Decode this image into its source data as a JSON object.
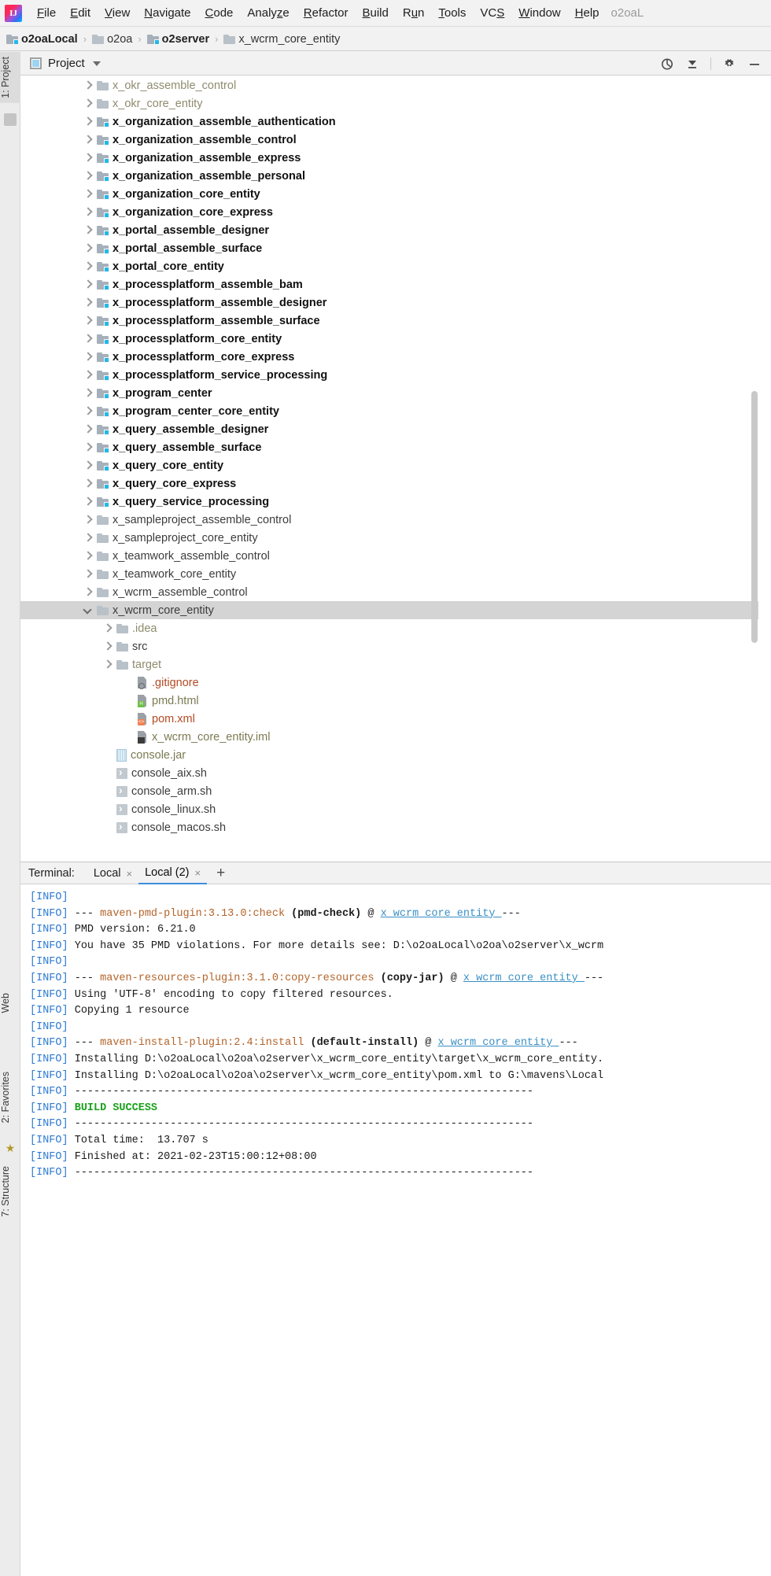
{
  "window": {
    "app_title_truncated": "o2oaL"
  },
  "menubar": {
    "items": [
      {
        "label": "File",
        "mnemonic": "F"
      },
      {
        "label": "Edit",
        "mnemonic": "E"
      },
      {
        "label": "View",
        "mnemonic": "V"
      },
      {
        "label": "Navigate",
        "mnemonic": "N"
      },
      {
        "label": "Code",
        "mnemonic": "C"
      },
      {
        "label": "Analyze",
        "mnemonic": "z"
      },
      {
        "label": "Refactor",
        "mnemonic": "R"
      },
      {
        "label": "Build",
        "mnemonic": "B"
      },
      {
        "label": "Run",
        "mnemonic": "u"
      },
      {
        "label": "Tools",
        "mnemonic": "T"
      },
      {
        "label": "VCS",
        "mnemonic": "S"
      },
      {
        "label": "Window",
        "mnemonic": "W"
      },
      {
        "label": "Help",
        "mnemonic": "H"
      }
    ]
  },
  "breadcrumb": {
    "items": [
      {
        "label": "o2oaLocal",
        "bold": true,
        "module": true
      },
      {
        "label": "o2oa",
        "bold": false,
        "module": false
      },
      {
        "label": "o2server",
        "bold": true,
        "module": true
      },
      {
        "label": "x_wcrm_core_entity",
        "bold": false,
        "module": false
      }
    ],
    "separator": "›"
  },
  "left_tool_strip": {
    "tabs": [
      {
        "label": "1: Project",
        "active": true
      },
      {
        "label": "Web",
        "active": false
      },
      {
        "label": "2: Favorites",
        "active": false
      },
      {
        "label": "7: Structure",
        "active": false
      }
    ]
  },
  "project_panel": {
    "title": "Project",
    "dropdown_icon": "chevron-down-icon",
    "actions": [
      {
        "name": "locate-in-tree-icon"
      },
      {
        "name": "collapse-all-icon"
      },
      {
        "name": "settings-gear-icon"
      },
      {
        "name": "hide-panel-icon"
      }
    ],
    "tree": [
      {
        "label": "x_okr_assemble_control",
        "indent": 1,
        "arrow": "right",
        "icon": "folder",
        "style": "dim"
      },
      {
        "label": "x_okr_core_entity",
        "indent": 1,
        "arrow": "right",
        "icon": "folder",
        "style": "dim"
      },
      {
        "label": "x_organization_assemble_authentication",
        "indent": 1,
        "arrow": "right",
        "icon": "module",
        "style": "module"
      },
      {
        "label": "x_organization_assemble_control",
        "indent": 1,
        "arrow": "right",
        "icon": "module",
        "style": "module"
      },
      {
        "label": "x_organization_assemble_express",
        "indent": 1,
        "arrow": "right",
        "icon": "module",
        "style": "module"
      },
      {
        "label": "x_organization_assemble_personal",
        "indent": 1,
        "arrow": "right",
        "icon": "module",
        "style": "module"
      },
      {
        "label": "x_organization_core_entity",
        "indent": 1,
        "arrow": "right",
        "icon": "module",
        "style": "module"
      },
      {
        "label": "x_organization_core_express",
        "indent": 1,
        "arrow": "right",
        "icon": "module",
        "style": "module"
      },
      {
        "label": "x_portal_assemble_designer",
        "indent": 1,
        "arrow": "right",
        "icon": "module",
        "style": "module"
      },
      {
        "label": "x_portal_assemble_surface",
        "indent": 1,
        "arrow": "right",
        "icon": "module",
        "style": "module"
      },
      {
        "label": "x_portal_core_entity",
        "indent": 1,
        "arrow": "right",
        "icon": "module",
        "style": "module"
      },
      {
        "label": "x_processplatform_assemble_bam",
        "indent": 1,
        "arrow": "right",
        "icon": "module",
        "style": "module"
      },
      {
        "label": "x_processplatform_assemble_designer",
        "indent": 1,
        "arrow": "right",
        "icon": "module",
        "style": "module"
      },
      {
        "label": "x_processplatform_assemble_surface",
        "indent": 1,
        "arrow": "right",
        "icon": "module",
        "style": "module"
      },
      {
        "label": "x_processplatform_core_entity",
        "indent": 1,
        "arrow": "right",
        "icon": "module",
        "style": "module"
      },
      {
        "label": "x_processplatform_core_express",
        "indent": 1,
        "arrow": "right",
        "icon": "module",
        "style": "module"
      },
      {
        "label": "x_processplatform_service_processing",
        "indent": 1,
        "arrow": "right",
        "icon": "module",
        "style": "module"
      },
      {
        "label": "x_program_center",
        "indent": 1,
        "arrow": "right",
        "icon": "module",
        "style": "module"
      },
      {
        "label": "x_program_center_core_entity",
        "indent": 1,
        "arrow": "right",
        "icon": "module",
        "style": "module"
      },
      {
        "label": "x_query_assemble_designer",
        "indent": 1,
        "arrow": "right",
        "icon": "module",
        "style": "module"
      },
      {
        "label": "x_query_assemble_surface",
        "indent": 1,
        "arrow": "right",
        "icon": "module",
        "style": "module"
      },
      {
        "label": "x_query_core_entity",
        "indent": 1,
        "arrow": "right",
        "icon": "module",
        "style": "module"
      },
      {
        "label": "x_query_core_express",
        "indent": 1,
        "arrow": "right",
        "icon": "module",
        "style": "module"
      },
      {
        "label": "x_query_service_processing",
        "indent": 1,
        "arrow": "right",
        "icon": "module",
        "style": "module"
      },
      {
        "label": "x_sampleproject_assemble_control",
        "indent": 1,
        "arrow": "right",
        "icon": "folder",
        "style": "folder"
      },
      {
        "label": "x_sampleproject_core_entity",
        "indent": 1,
        "arrow": "right",
        "icon": "folder",
        "style": "folder"
      },
      {
        "label": "x_teamwork_assemble_control",
        "indent": 1,
        "arrow": "right",
        "icon": "folder",
        "style": "folder"
      },
      {
        "label": "x_teamwork_core_entity",
        "indent": 1,
        "arrow": "right",
        "icon": "folder",
        "style": "folder"
      },
      {
        "label": "x_wcrm_assemble_control",
        "indent": 1,
        "arrow": "right",
        "icon": "folder",
        "style": "folder"
      },
      {
        "label": "x_wcrm_core_entity",
        "indent": 1,
        "arrow": "down",
        "icon": "folder",
        "style": "folder",
        "selected": true
      },
      {
        "label": ".idea",
        "indent": 2,
        "arrow": "right",
        "icon": "folder",
        "style": "dim"
      },
      {
        "label": "src",
        "indent": 2,
        "arrow": "right",
        "icon": "folder",
        "style": "folder"
      },
      {
        "label": "target",
        "indent": 2,
        "arrow": "right",
        "icon": "folder",
        "style": "dim"
      },
      {
        "label": ".gitignore",
        "indent": 3,
        "arrow": "none",
        "icon": "file-ignored",
        "style": "red"
      },
      {
        "label": "pmd.html",
        "indent": 3,
        "arrow": "none",
        "icon": "file-html",
        "style": "olive"
      },
      {
        "label": "pom.xml",
        "indent": 3,
        "arrow": "none",
        "icon": "file-xml",
        "style": "red"
      },
      {
        "label": "x_wcrm_core_entity.iml",
        "indent": 3,
        "arrow": "none",
        "icon": "file-iml",
        "style": "olive"
      },
      {
        "label": "console.jar",
        "indent": 2,
        "arrow": "none",
        "icon": "file-jar",
        "style": "olive"
      },
      {
        "label": "console_aix.sh",
        "indent": 2,
        "arrow": "none",
        "icon": "file-sh",
        "style": "folder"
      },
      {
        "label": "console_arm.sh",
        "indent": 2,
        "arrow": "none",
        "icon": "file-sh",
        "style": "folder"
      },
      {
        "label": "console_linux.sh",
        "indent": 2,
        "arrow": "none",
        "icon": "file-sh",
        "style": "folder"
      },
      {
        "label": "console_macos.sh",
        "indent": 2,
        "arrow": "none",
        "icon": "file-sh",
        "style": "folder"
      }
    ]
  },
  "terminal": {
    "label": "Terminal:",
    "tabs": [
      {
        "label": "Local",
        "active": false,
        "close": "×"
      },
      {
        "label": "Local (2)",
        "active": true,
        "close": "×"
      }
    ],
    "add_tab": "+",
    "lines": [
      [
        {
          "t": "[INFO] ",
          "c": "c-info"
        }
      ],
      [
        {
          "t": "[INFO] ",
          "c": "c-info"
        },
        {
          "t": "--- ",
          "c": "c-dark"
        },
        {
          "t": "maven-pmd-plugin:3.13.0:check ",
          "c": "c-goal"
        },
        {
          "t": "(pmd-check) ",
          "c": "c-phase"
        },
        {
          "t": "@ ",
          "c": "c-dark"
        },
        {
          "t": "x_wcrm_core_entity ",
          "c": "c-proj"
        },
        {
          "t": "---",
          "c": "c-dark"
        }
      ],
      [
        {
          "t": "[INFO] ",
          "c": "c-info"
        },
        {
          "t": "PMD version: 6.21.0",
          "c": "c-dark"
        }
      ],
      [
        {
          "t": "[INFO] ",
          "c": "c-info"
        },
        {
          "t": "You have 35 PMD violations. For more details see: D:\\o2oaLocal\\o2oa\\o2server\\x_wcrm",
          "c": "c-dark"
        }
      ],
      [
        {
          "t": "[INFO] ",
          "c": "c-info"
        }
      ],
      [
        {
          "t": "[INFO] ",
          "c": "c-info"
        },
        {
          "t": "--- ",
          "c": "c-dark"
        },
        {
          "t": "maven-resources-plugin:3.1.0:copy-resources ",
          "c": "c-goal"
        },
        {
          "t": "(copy-jar) ",
          "c": "c-phase"
        },
        {
          "t": "@ ",
          "c": "c-dark"
        },
        {
          "t": "x_wcrm_core_entity ",
          "c": "c-proj"
        },
        {
          "t": "---",
          "c": "c-dark"
        }
      ],
      [
        {
          "t": "[INFO] ",
          "c": "c-info"
        },
        {
          "t": "Using 'UTF-8' encoding to copy filtered resources.",
          "c": "c-dark"
        }
      ],
      [
        {
          "t": "[INFO] ",
          "c": "c-info"
        },
        {
          "t": "Copying 1 resource",
          "c": "c-dark"
        }
      ],
      [
        {
          "t": "[INFO] ",
          "c": "c-info"
        }
      ],
      [
        {
          "t": "[INFO] ",
          "c": "c-info"
        },
        {
          "t": "--- ",
          "c": "c-dark"
        },
        {
          "t": "maven-install-plugin:2.4:install ",
          "c": "c-goal"
        },
        {
          "t": "(default-install) ",
          "c": "c-phase"
        },
        {
          "t": "@ ",
          "c": "c-dark"
        },
        {
          "t": "x_wcrm_core_entity ",
          "c": "c-proj"
        },
        {
          "t": "---",
          "c": "c-dark"
        }
      ],
      [
        {
          "t": "[INFO] ",
          "c": "c-info"
        },
        {
          "t": "Installing D:\\o2oaLocal\\o2oa\\o2server\\x_wcrm_core_entity\\target\\x_wcrm_core_entity.",
          "c": "c-dark"
        }
      ],
      [
        {
          "t": "[INFO] ",
          "c": "c-info"
        },
        {
          "t": "Installing D:\\o2oaLocal\\o2oa\\o2server\\x_wcrm_core_entity\\pom.xml to G:\\mavens\\Local",
          "c": "c-dark"
        }
      ],
      [
        {
          "t": "[INFO] ",
          "c": "c-info"
        },
        {
          "t": "------------------------------------------------------------------------",
          "c": "c-dark"
        }
      ],
      [
        {
          "t": "[INFO] ",
          "c": "c-info"
        },
        {
          "t": "BUILD SUCCESS",
          "c": "c-green"
        }
      ],
      [
        {
          "t": "[INFO] ",
          "c": "c-info"
        },
        {
          "t": "------------------------------------------------------------------------",
          "c": "c-dark"
        }
      ],
      [
        {
          "t": "[INFO] ",
          "c": "c-info"
        },
        {
          "t": "Total time:  13.707 s",
          "c": "c-dark"
        }
      ],
      [
        {
          "t": "[INFO] ",
          "c": "c-info"
        },
        {
          "t": "Finished at: 2021-02-23T15:00:12+08:00",
          "c": "c-dark"
        }
      ],
      [
        {
          "t": "[INFO] ",
          "c": "c-info"
        },
        {
          "t": "------------------------------------------------------------------------",
          "c": "c-dark"
        }
      ]
    ]
  },
  "colors": {
    "accent_blue": "#24b8e8",
    "info_blue": "#2e7ad1",
    "success_green": "#1aa11a",
    "goal_orange": "#b3642a",
    "selection_grey": "#d4d4d4"
  }
}
